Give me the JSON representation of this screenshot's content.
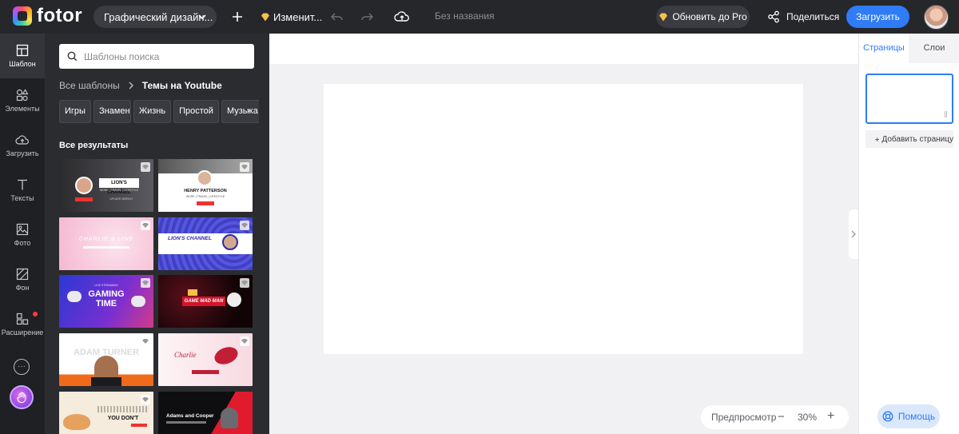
{
  "app": {
    "logo_text": "fotor",
    "doc_title": "Без названия"
  },
  "topbar": {
    "design_type": "Графический дизайн...",
    "resize_label": "Изменит...",
    "pro_label": "Обновить до Pro",
    "share_label": "Поделиться",
    "upload_label": "Загрузить"
  },
  "rail": {
    "items": [
      {
        "label": "Шаблон",
        "icon": "template-icon"
      },
      {
        "label": "Элементы",
        "icon": "elements-icon"
      },
      {
        "label": "Загрузить",
        "icon": "cloud-upload-icon"
      },
      {
        "label": "Тексты",
        "icon": "text-icon"
      },
      {
        "label": "Фото",
        "icon": "photo-icon"
      },
      {
        "label": "Фон",
        "icon": "background-icon"
      },
      {
        "label": "Расширение",
        "icon": "extension-icon"
      }
    ]
  },
  "panel": {
    "search_placeholder": "Шаблоны поиска",
    "breadcrumb_root": "Все шаблоны",
    "breadcrumb_current": "Темы на Youtube",
    "chips": [
      "Игры",
      "Знаменитости",
      "Жизнь",
      "Простой",
      "Музыка"
    ],
    "chips_visible": [
      "Игры",
      "Знаменитости",
      "Жизнь",
      "Простой",
      "Музыка"
    ],
    "results_title": "Все результаты",
    "templates": [
      {
        "text": "LION'S CHANNEL",
        "sub": "WORK | TRAVEL | LIFESTYLE",
        "extra": "UPDATE WEEKLY",
        "bg": "#3a3a3e"
      },
      {
        "text": "HENRY PATTERSON",
        "sub": "WORK | TRAVEL | LIFESTYLE",
        "bg": "#ffffff"
      },
      {
        "text": "CHARLIE & LINE",
        "bg": "#f7c1d6"
      },
      {
        "text": "LION'S CHANNEL",
        "bg": "#4b4cd6"
      },
      {
        "text": "GAMING TIME",
        "sub": "LIVE STREAMING",
        "bg": "#3b2fc7"
      },
      {
        "text": "GAME MAD MAN",
        "bg": "#140608"
      },
      {
        "text": "ADAM TURNER",
        "bg": "#ffffff"
      },
      {
        "text": "Charlie",
        "bg": "#fbe9ee"
      },
      {
        "text": "YOU DON'T",
        "bg": "#f5ecdd"
      },
      {
        "text": "Adams and Cooper",
        "bg": "#0e0e10"
      }
    ]
  },
  "canvas": {
    "preview_label": "Предпросмотр",
    "zoom_level": "30%",
    "zoom_out": "−",
    "zoom_in": "+"
  },
  "right_panel": {
    "tab_pages": "Страницы",
    "tab_layers": "Слои",
    "add_page_label": "Добавить страницу"
  },
  "help_label": "Помощь",
  "colors": {
    "accent": "#2f7cf6",
    "topbar": "#26272b",
    "panel": "#2b2c30",
    "gold": "#f3c14b"
  }
}
